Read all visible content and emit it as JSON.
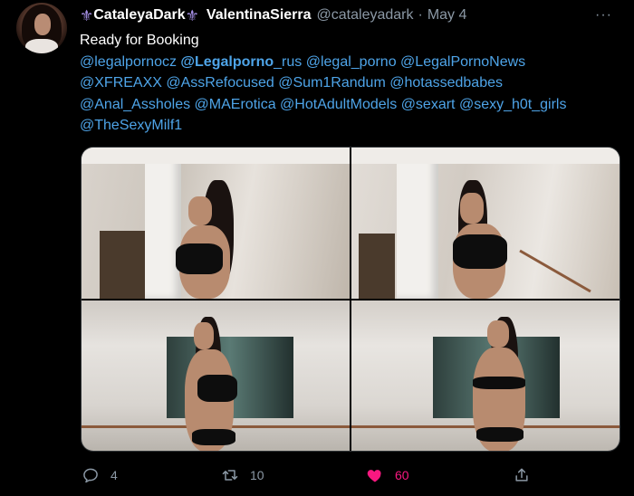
{
  "author": {
    "display_name": "CataleyaDark",
    "real_name": "ValentinaSierra",
    "handle": "@cataleyadark",
    "separator": "·",
    "date": "May 4",
    "emoji_icon": "fleur-de-lis-icon",
    "emoji_glyph": "⚜",
    "emoji_color": "#a58fe6"
  },
  "more_label": "···",
  "tweet": {
    "text": "Ready for Booking",
    "mentions_line1": [
      "@legalpornocz",
      "@Legalporno",
      "_rus",
      "@legal_porno",
      "@LegalPornoNews"
    ],
    "mentions_line2": [
      "@XFREAXX",
      "@AssRefocused",
      "@Sum1Randum",
      "@hotassedbabes"
    ],
    "mentions_line3": [
      "@Anal_Assholes",
      "@MAErotica",
      "@HotAdultModels",
      "@sexart",
      "@sexy_h0t_girls"
    ],
    "mentions_line4": [
      "@TheSexyMilf1"
    ]
  },
  "media": {
    "count": 4,
    "alt": [
      "photo-1",
      "photo-2",
      "photo-3",
      "photo-4"
    ]
  },
  "actions": {
    "reply_count": "4",
    "retweet_count": "10",
    "like_count": "60",
    "liked": true,
    "like_color": "#f91880",
    "muted_color": "#8b98a5",
    "link_color": "#4ea4e8"
  }
}
